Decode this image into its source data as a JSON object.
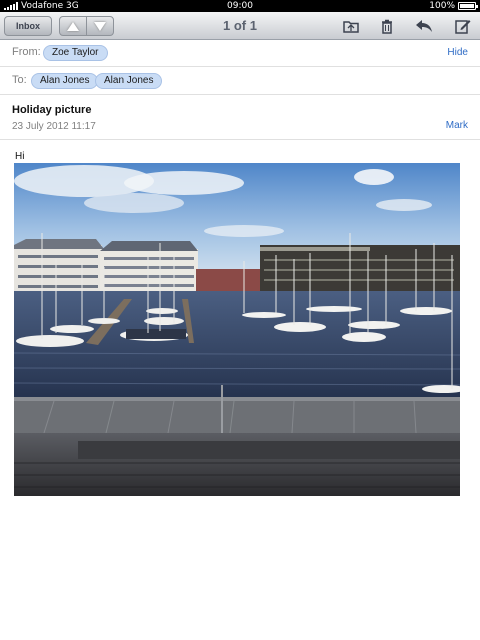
{
  "status_bar": {
    "carrier": "Vodafone 3G",
    "time": "09:00",
    "battery": "100%",
    "battery_level": 1.0
  },
  "toolbar": {
    "inbox_label": "Inbox",
    "page_indicator": "1 of 1",
    "icons": [
      "chevron-up-icon",
      "chevron-down-icon",
      "folder-icon",
      "trash-icon",
      "reply-icon",
      "compose-icon"
    ]
  },
  "message": {
    "from_label": "From:",
    "from": "Zoe Taylor",
    "hide_label": "Hide",
    "to_label": "To:",
    "to": [
      "Alan Jones",
      "Alan Jones"
    ],
    "subject": "Holiday picture",
    "date": "23 July 2012 11:17",
    "mark_label": "Mark",
    "body": "Hi"
  },
  "colors": {
    "accent": "#2f6cc5",
    "chip": "#c9dcf5"
  }
}
